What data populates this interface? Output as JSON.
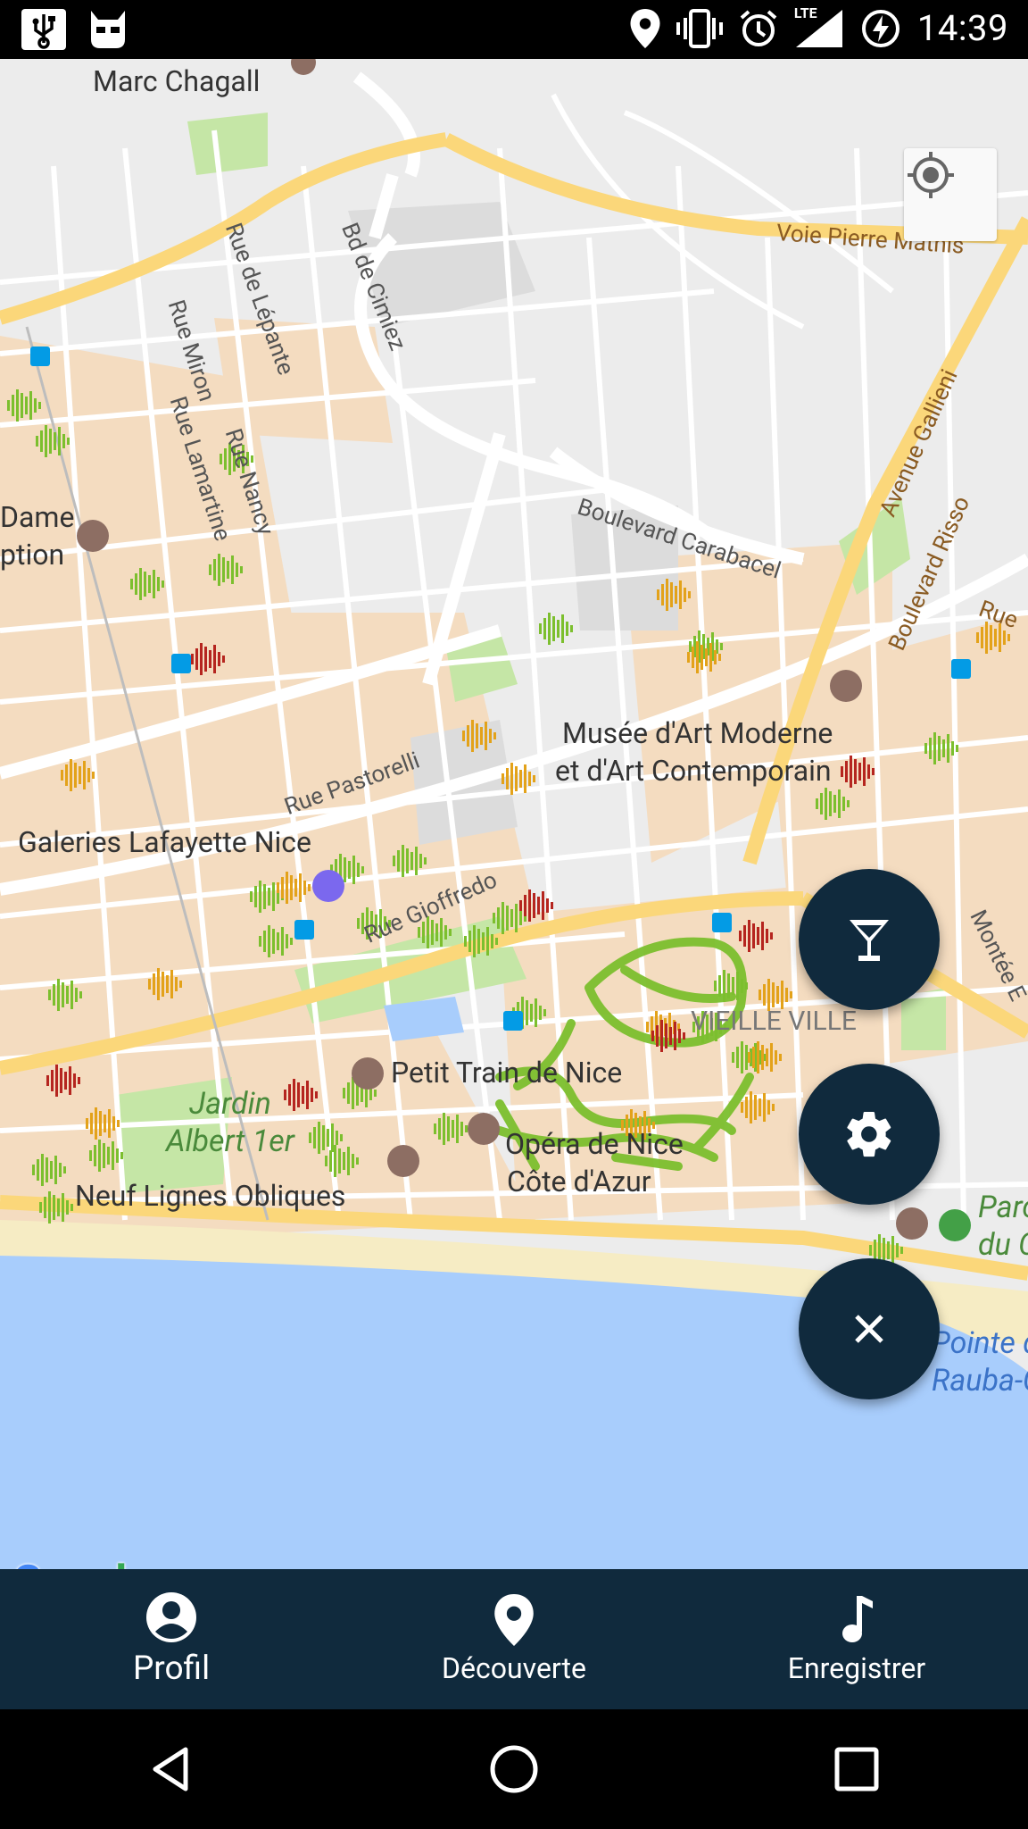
{
  "status_bar": {
    "time": "14:39",
    "network": "LTE",
    "icons": [
      "usb-icon",
      "android-debug-icon",
      "location-icon",
      "vibrate-icon",
      "alarm-icon",
      "signal-icon",
      "battery-charging-icon"
    ]
  },
  "map": {
    "labels": {
      "marc_chagall": "Marc Chagall",
      "voie_pierre_mathis": "Voie Pierre Mathis",
      "bd_de_cimiez": "Bd de Cimiez",
      "rue_de_lepante": "Rue de Lépante",
      "rue_miron": "Rue Miron",
      "rue_lamartine": "Rue Lamartine",
      "rue_nancy": "Rue Nancy",
      "boulevard_carabacel": "Boulevard Carabacel",
      "avenue_gallieni": "Avenue Gallieni",
      "boulevard_risso": "Boulevard Risso",
      "rue_partial": "Rue",
      "dame": "Dame",
      "ption": "ption",
      "musee_line1": "Musée d'Art Moderne",
      "musee_line2": "et d'Art Contemporain",
      "rue_pastorelli": "Rue Pastorelli",
      "galeries_lafayette": "Galeries Lafayette Nice",
      "rue_gioffredo": "Rue Gioffredo",
      "vieille_ville": "VIEILLE VILLE",
      "montee": "Montée E",
      "petit_train": "Petit Train de Nice",
      "jardin_line1": "Jardin",
      "jardin_line2": "Albert 1er",
      "opera_line1": "Opéra de Nice",
      "opera_line2": "Côte d'Azur",
      "neuf_lignes": "Neuf Lignes Obliques",
      "parc_line1": "Parc",
      "parc_line2": "du C",
      "pointe_line1": "Pointe d",
      "pointe_line2": "Rauba-Cap"
    },
    "logo": [
      "G",
      "o",
      "o",
      "g",
      "l",
      "e"
    ],
    "colors": {
      "sound_green": "#7cbf2e",
      "sound_orange": "#e3a21a",
      "sound_red": "#b5251f",
      "water": "#a8cdfc",
      "park": "#c5e6a6",
      "urban": "#f4dcc0",
      "road_major": "#fbd77a"
    }
  },
  "fabs": {
    "drink": "cocktail-icon",
    "settings": "gear-icon",
    "close": "close-icon",
    "color": "#102a3d"
  },
  "bottom_nav": {
    "items": [
      {
        "label": "Profil",
        "icon": "account-circle-icon"
      },
      {
        "label": "Découverte",
        "icon": "map-marker-icon"
      },
      {
        "label": "Enregistrer",
        "icon": "music-note-icon"
      }
    ]
  },
  "system_nav": {
    "back": "back-icon",
    "home": "home-icon",
    "recents": "recents-icon"
  }
}
